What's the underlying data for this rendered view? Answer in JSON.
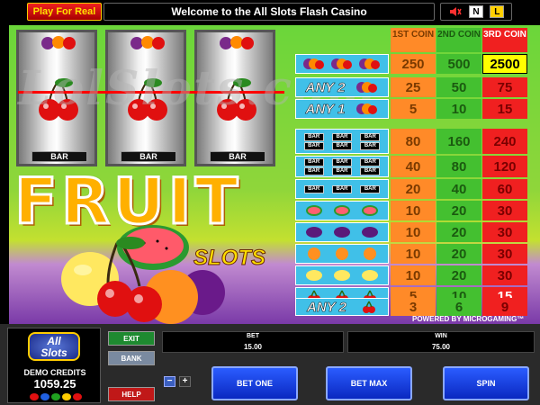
{
  "topbar": {
    "play_real": "Play For Real",
    "welcome": "Welcome to the All Slots Flash Casino",
    "icon_n": "N",
    "icon_l": "L"
  },
  "game": {
    "watermark": "LolSlots.com",
    "title": "FRUIT",
    "subtitle": "SLOTS",
    "reel_bar_label": "BAR",
    "powered_by": "POWERED BY MICROGAMING™"
  },
  "paytable": {
    "headers": [
      "1ST COIN",
      "2ND COIN",
      "3RD COIN"
    ],
    "any2_label": "ANY 2",
    "any1_label": "ANY 1",
    "bar_label": "BAR",
    "rows": [
      {
        "symbol": "mixed-fruit",
        "v1": "250",
        "v2": "500",
        "v3": "2500"
      },
      {
        "symbol": "any2-mixed",
        "v1": "25",
        "v2": "50",
        "v3": "75"
      },
      {
        "symbol": "any1-mixed",
        "v1": "5",
        "v2": "10",
        "v3": "15"
      },
      {
        "symbol": "triple-bar",
        "v1": "80",
        "v2": "160",
        "v3": "240"
      },
      {
        "symbol": "double-bar",
        "v1": "40",
        "v2": "80",
        "v3": "120"
      },
      {
        "symbol": "single-bar",
        "v1": "20",
        "v2": "40",
        "v3": "60"
      },
      {
        "symbol": "watermelon",
        "v1": "10",
        "v2": "20",
        "v3": "30"
      },
      {
        "symbol": "plum",
        "v1": "10",
        "v2": "20",
        "v3": "30"
      },
      {
        "symbol": "orange",
        "v1": "10",
        "v2": "20",
        "v3": "30"
      },
      {
        "symbol": "lemon",
        "v1": "10",
        "v2": "20",
        "v3": "30"
      },
      {
        "symbol": "cherry",
        "v1": "5",
        "v2": "10",
        "v3": "15"
      },
      {
        "symbol": "any2-cherry",
        "v1": "3",
        "v2": "6",
        "v3": "9"
      }
    ]
  },
  "bottom": {
    "logo_line1": "All",
    "logo_line2": "Slots",
    "demo_label": "DEMO CREDITS",
    "demo_value": "1059.25",
    "exit": "EXIT",
    "bank": "BANK",
    "help": "HELP",
    "bet_label": "BET",
    "bet_value": "15.00",
    "win_label": "WIN",
    "win_value": "75.00",
    "minus": "−",
    "plus": "+",
    "bet_one": "BET ONE",
    "bet_max": "BET MAX",
    "spin": "SPIN"
  },
  "colors": {
    "coin1": "#ff8a28",
    "coin2": "#44c030",
    "coin3": "#f02020",
    "highlight": "#ffff00",
    "symbol_bg": "#40c0e8"
  }
}
